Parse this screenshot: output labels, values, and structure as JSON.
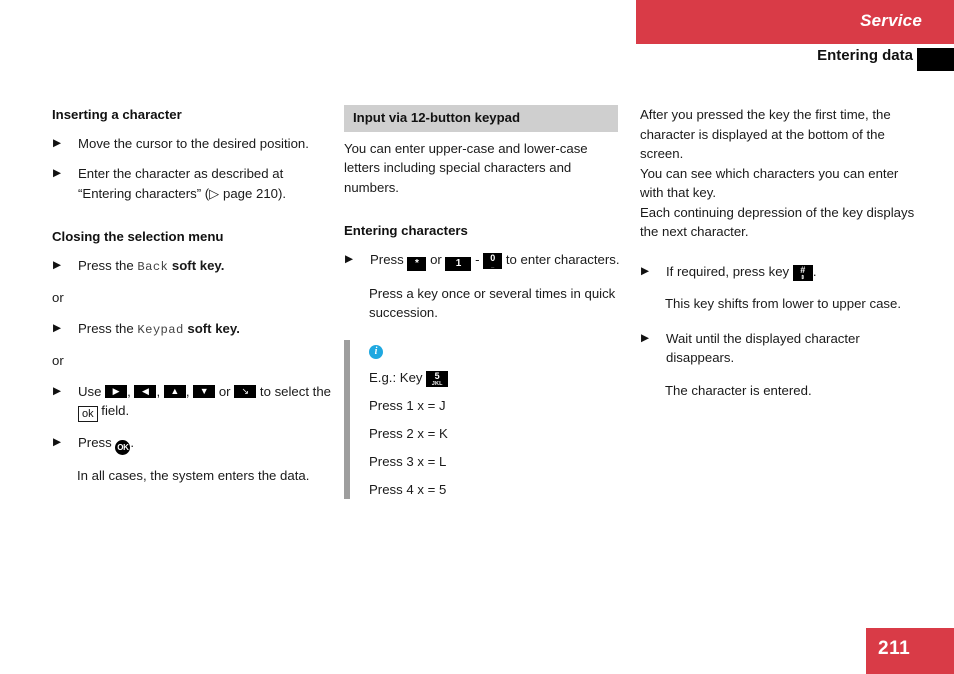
{
  "header": {
    "chapter_title": "Service",
    "section_title": "Entering data",
    "band_color": "#d93b47",
    "black_marker": ""
  },
  "left_column": {
    "heading_1": "Inserting a character",
    "items": [
      {
        "text_before": "Move the cursor to the desired position.",
        "text_after": ""
      },
      {
        "text_before": "Enter the character as described at “Entering characters” (▷ page 210).",
        "text_after": ""
      }
    ],
    "heading_2": "Closing the selection menu",
    "press_back_prefix": "Press the",
    "back_key_label": "Back",
    "press_back_suffix": "soft key.",
    "or_1": "or",
    "press_keypad_prefix": "Press the",
    "keypad_key_label": "Keypad",
    "press_keypad_suffix": "soft key.",
    "or_2": "or",
    "use_prefix": "Use",
    "arrow_right": "▶",
    "arrow_left": "◀",
    "arrow_up": "▲",
    "arrow_down": "▼",
    "arrow_diag": "↘",
    "use_middle_or": "or",
    "use_suffix": "to select the",
    "ok_field_label": "ok",
    "use_end": "field.",
    "press_ok_prefix": "Press",
    "ok_button_label": "OK",
    "press_ok_suffix": ".",
    "final_note": "In all cases, the system enters the data."
  },
  "middle_column": {
    "grey_heading": "Input via 12-button keypad",
    "intro": "You can enter upper-case and lower-case letters including special characters and numbers.",
    "heading_entering": "Entering characters",
    "press_prefix": "Press",
    "key_star": "*",
    "or_word": "or",
    "key_one": "1",
    "dash": "-",
    "key_zero": "0",
    "key_zero_sub": "_",
    "press_suffix": "to enter characters.",
    "press_note": "Press a key once or several times in quick succession.",
    "info": {
      "icon": "i",
      "eg_prefix": "E.g.: Key",
      "eg_key_main": "5",
      "eg_key_sub": "JKL",
      "lines": [
        "Press 1 x = J",
        "Press 2 x = K",
        "Press 3 x = L",
        "Press 4 x = 5"
      ]
    }
  },
  "right_column": {
    "paragraph_1": "After you pressed the key the first time, the character is displayed at the bottom of the screen.",
    "paragraph_2": "You can see which characters you can enter with that key.",
    "paragraph_3": "Each continuing depression of the key displays the next character.",
    "item_shift_prefix": "If required, press key",
    "key_hash_main": "#",
    "key_hash_sub": "⇕",
    "item_shift_suffix": ".",
    "shift_note": "This key shifts from lower to upper case.",
    "item_wait": "Wait until the displayed character disappears.",
    "wait_note": "The character is entered."
  },
  "footer": {
    "page_number": "211"
  }
}
